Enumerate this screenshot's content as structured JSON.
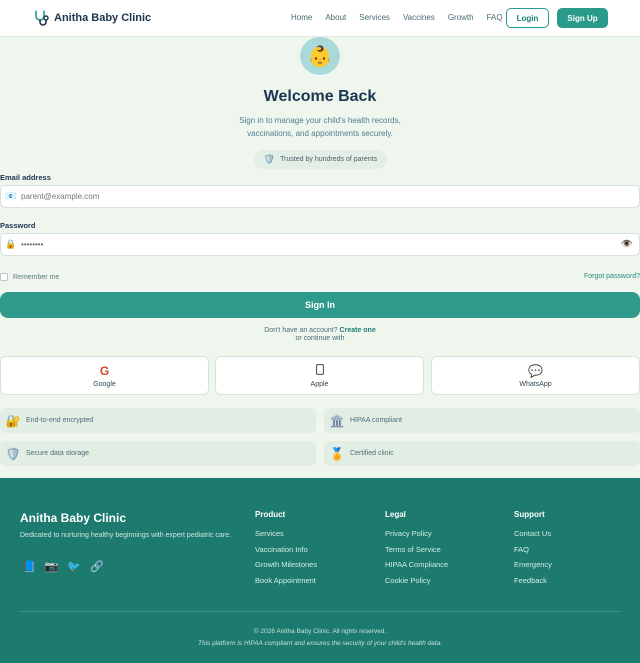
{
  "header": {
    "brand_name": "Anitha Baby Clinic",
    "nav": [
      "Home",
      "About",
      "Services",
      "Vaccines",
      "Growth",
      "FAQ"
    ],
    "login_label": "Login",
    "signup_label": "Sign Up"
  },
  "hero": {
    "avatar_icon": "baby-icon",
    "title": "Welcome Back",
    "subtitle": "Sign in to manage your child's health records, vaccinations, and appointments securely.",
    "trust_text": "Trusted by hundreds of parents"
  },
  "form": {
    "email_label": "Email address",
    "email_placeholder": "parent@example.com",
    "password_label": "Password",
    "password_value": "••••••••",
    "remember_label": "Remember me",
    "forgot_label": "Forgot password?",
    "signin_label": "Sign In",
    "no_account": "Don't have an account?",
    "create_one": "Create one",
    "continue_with": "or continue with"
  },
  "social": [
    {
      "label": "Google",
      "icon": "G"
    },
    {
      "label": "Apple",
      "icon": ""
    },
    {
      "label": "WhatsApp",
      "icon": "💬"
    }
  ],
  "badges": [
    {
      "label": "End-to-end encrypted",
      "icon": "🔐"
    },
    {
      "label": "HIPAA compliant",
      "icon": "🏛️"
    },
    {
      "label": "Secure data storage",
      "icon": "🛡️"
    },
    {
      "label": "Certified clinic",
      "icon": "🏅"
    }
  ],
  "footer": {
    "brand": "Anitha Baby Clinic",
    "desc": "Dedicated to nurturing healthy beginnings with expert pediatric care.",
    "columns": [
      {
        "title": "Product",
        "links": [
          "Services",
          "Vaccination Info",
          "Growth Milestones",
          "Book Appointment"
        ]
      },
      {
        "title": "Legal",
        "links": [
          "Privacy Policy",
          "Terms of Service",
          "HIPAA Compliance",
          "Cookie Policy"
        ]
      },
      {
        "title": "Support",
        "links": [
          "Contact Us",
          "FAQ",
          "Emergency",
          "Feedback"
        ]
      }
    ],
    "copyright": "© 2026 Anitha Baby Clinic. All rights reserved.",
    "note": "This platform is HIPAA compliant and ensures the security of your child's health data."
  },
  "colors": {
    "accent": "#2a9a8a",
    "footer_bg": "#1d7a6e",
    "page_bg": "#eef6ee",
    "heading": "#1b3550"
  }
}
